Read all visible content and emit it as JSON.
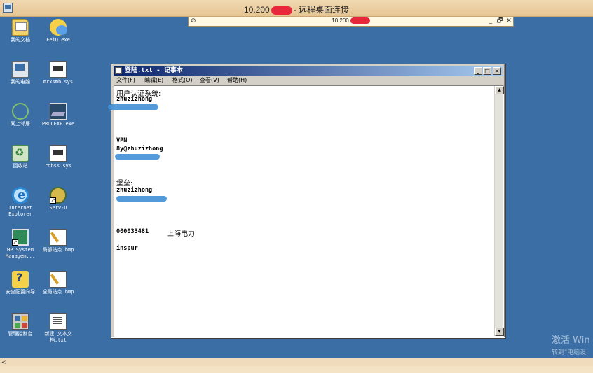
{
  "rdp": {
    "title_prefix": "10.200",
    "title_suffix": "- 远程桌面连接",
    "connection_bar_title": "10.200",
    "ctrl_minimize": "_",
    "ctrl_restore": "🗗",
    "ctrl_close": "✕",
    "pin_glyph": "⊘"
  },
  "desktop_icons": [
    {
      "label": "我的文档",
      "icon": "my-documents-icon"
    },
    {
      "label": "我的电脑",
      "icon": "my-computer-icon"
    },
    {
      "label": "网上邻居",
      "icon": "network-places-icon"
    },
    {
      "label": "回收站",
      "icon": "recycle-bin-icon"
    },
    {
      "label": "Internet Explorer",
      "icon": "internet-explorer-icon"
    },
    {
      "label": "HP System Managem...",
      "icon": "hp-system-management-icon"
    },
    {
      "label": "安全配置向导",
      "icon": "security-wizard-icon"
    },
    {
      "label": "管理控制台",
      "icon": "management-console-icon"
    },
    {
      "label": "FeiQ.exe",
      "icon": "feiq-icon"
    },
    {
      "label": "mrxsmb.sys",
      "icon": "mrxsmb-sys-icon"
    },
    {
      "label": "PROCEXP.exe",
      "icon": "procexp-icon"
    },
    {
      "label": "rdbss.sys",
      "icon": "rdbss-sys-icon"
    },
    {
      "label": "Serv-U",
      "icon": "serv-u-icon"
    },
    {
      "label": "局部站点.bmp",
      "icon": "local-site-bmp-icon"
    },
    {
      "label": "全局站点.bmp",
      "icon": "global-site-bmp-icon"
    },
    {
      "label": "新建 文本文档.txt",
      "icon": "new-text-document-icon"
    }
  ],
  "notepad": {
    "title": "登陆.txt - 记事本",
    "btn_min": "_",
    "btn_max": "□",
    "btn_close": "×",
    "menu": [
      "文件(F)",
      "编辑(E)",
      "格式(O)",
      "查看(V)",
      "帮助(H)"
    ],
    "lines": {
      "auth_header": "用户认证系统:",
      "auth_user": "zhuzizhong",
      "vpn_header": "VPN",
      "vpn_user": "8y@zhuzizhong",
      "bastion_header": "堡垒:",
      "bastion_user": "zhuzizhong",
      "account_number": "000033481",
      "company": "上海电力",
      "inspur": "inspur"
    },
    "scroll_up": "▲",
    "scroll_down": "▼"
  },
  "hscroll_arrow": "<",
  "watermark": {
    "line1": "激活 Win",
    "line2": "转到\"电脑设"
  }
}
